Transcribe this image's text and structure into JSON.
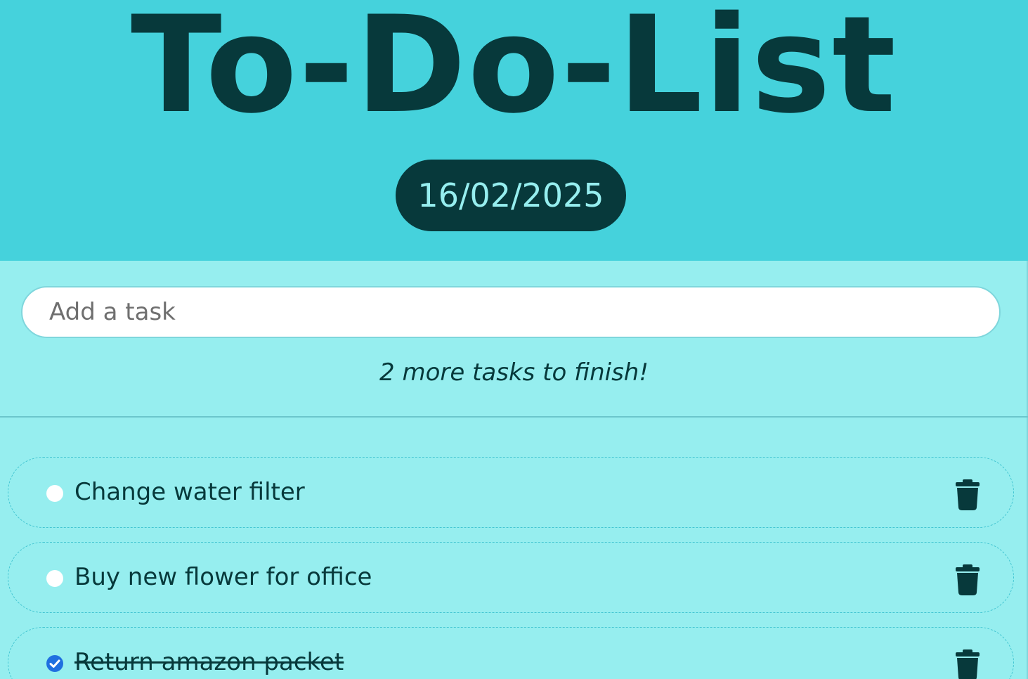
{
  "header": {
    "title": "To-Do-List",
    "date": "16/02/2025"
  },
  "input": {
    "placeholder": "Add a task",
    "value": ""
  },
  "status": {
    "remaining_text": "2 more tasks to finish!"
  },
  "tasks": [
    {
      "label": "Change water filter",
      "done": false
    },
    {
      "label": "Buy new flower for office",
      "done": false
    },
    {
      "label": "Return amazon packet",
      "done": true
    }
  ],
  "icons": {
    "check": "check-circle-icon",
    "unchecked": "circle-icon",
    "delete": "trash-icon"
  },
  "colors": {
    "header_bg": "#45d2dc",
    "body_bg": "#96eeef",
    "dark": "#07393b",
    "check_done": "#1f6fe0"
  }
}
